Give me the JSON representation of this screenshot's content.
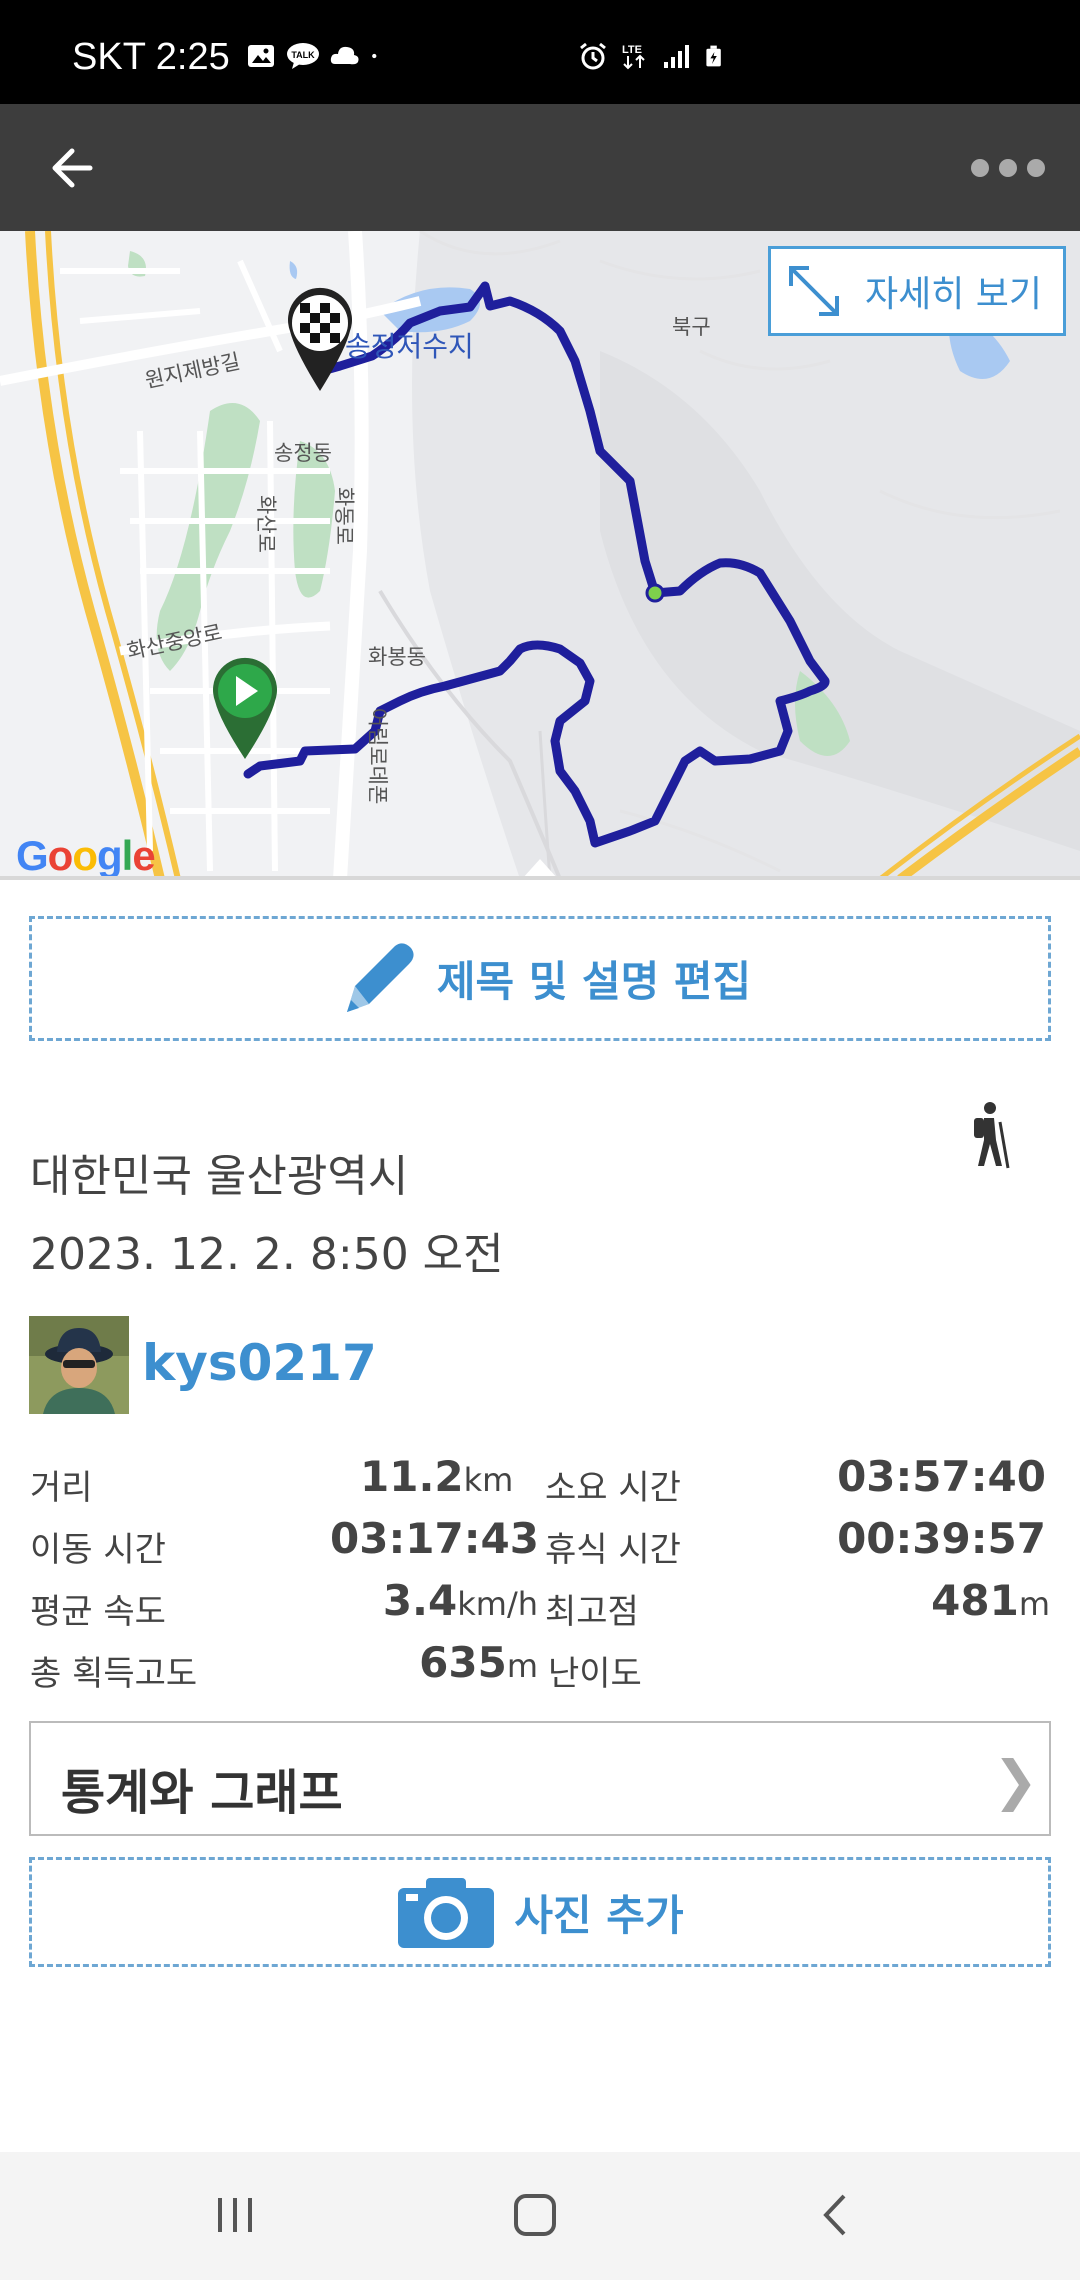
{
  "status_bar": {
    "carrier_time": "SKT 2:25",
    "icons": [
      "image-icon",
      "kakaotalk-icon",
      "cloud-icon",
      "dot-icon",
      "alarm-icon",
      "lte-icon",
      "signal-icon",
      "battery-icon"
    ]
  },
  "app_bar": {
    "back_icon": "arrow-left-icon",
    "menu_icon": "more-icon"
  },
  "map": {
    "detail_button_label": "자세히 보기",
    "labels": {
      "reservoir": "송정저수지",
      "bukgu": "북구",
      "road1": "원지제방길",
      "songjeong": "송정동",
      "hwasan_ro": "화산로",
      "hwabong_ro": "화동로",
      "hwasanjung": "화산중앙로",
      "hwabong": "화봉동",
      "road2": "어림로데폰"
    },
    "google_logo": "Google",
    "route_color": "#1f1f9c",
    "start_color": "#2ea84a",
    "finish_pattern": "checkered-flag"
  },
  "edit": {
    "label": "제목 및 설명 편집"
  },
  "activity": {
    "location": "대한민국 울산광역시",
    "datetime": "2023. 12. 2. 8:50 오전",
    "type_icon": "hiking-icon"
  },
  "user": {
    "name": "kys0217"
  },
  "stats": {
    "distance_label": "거리",
    "distance_value": "11.2",
    "distance_unit": "km",
    "duration_label": "소요 시간",
    "duration_value": "03:57:40",
    "moving_label": "이동 시간",
    "moving_value": "03:17:43",
    "rest_label": "휴식 시간",
    "rest_value": "00:39:57",
    "speed_label": "평균 속도",
    "speed_value": "3.4",
    "speed_unit": "km/h",
    "peak_label": "최고점",
    "peak_value": "481",
    "peak_unit": "m",
    "gain_label": "총 획득고도",
    "gain_value": "635",
    "gain_unit": "m",
    "difficulty_label": "난이도"
  },
  "stats_button": {
    "label": "통계와 그래프",
    "chevron": "❯"
  },
  "photo": {
    "label": "사진 추가"
  },
  "nav": {
    "icons": [
      "recents-icon",
      "home-icon",
      "back-icon"
    ]
  }
}
